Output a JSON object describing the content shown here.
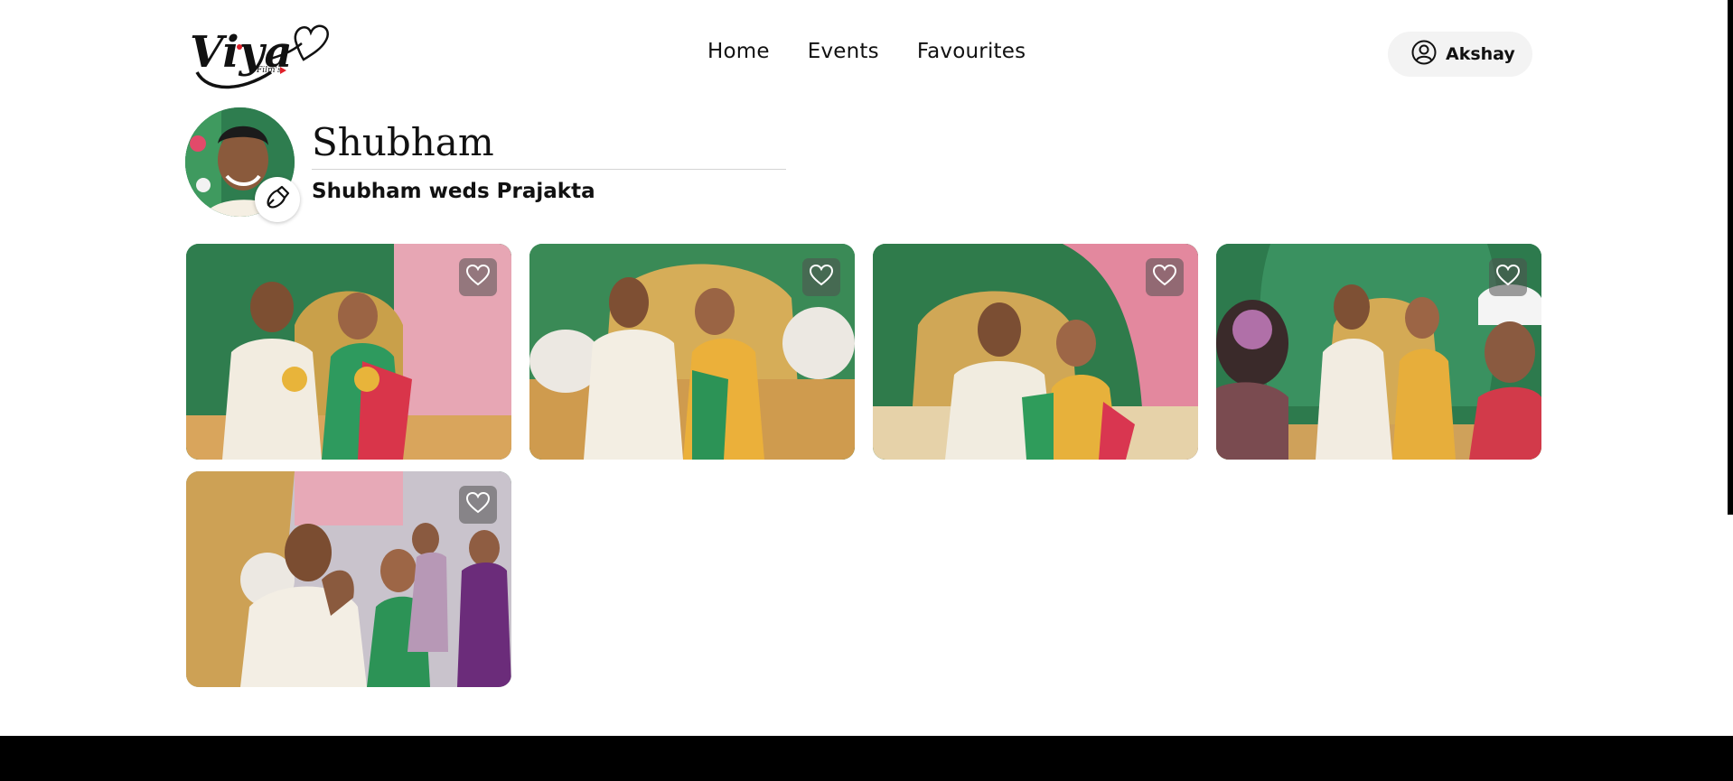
{
  "brand": {
    "logo_text": "Viya",
    "logo_subtext": "Film's"
  },
  "nav": {
    "items": [
      {
        "label": "Home"
      },
      {
        "label": "Events"
      },
      {
        "label": "Favourites"
      }
    ]
  },
  "user": {
    "name": "Akshay",
    "icon": "user-circle-icon"
  },
  "profile": {
    "name": "Shubham",
    "event_title": "Shubham weds Prajakta",
    "edit_icon": "edit-icon"
  },
  "gallery": {
    "favourite_icon": "heart-icon",
    "photos": [
      {
        "favourited": false
      },
      {
        "favourited": false
      },
      {
        "favourited": false
      },
      {
        "favourited": false
      },
      {
        "favourited": false
      }
    ]
  },
  "colors": {
    "text": "#111111",
    "pill_bg": "#f3f3f3",
    "footer": "#000000",
    "logo_accent": "#e0202a"
  }
}
